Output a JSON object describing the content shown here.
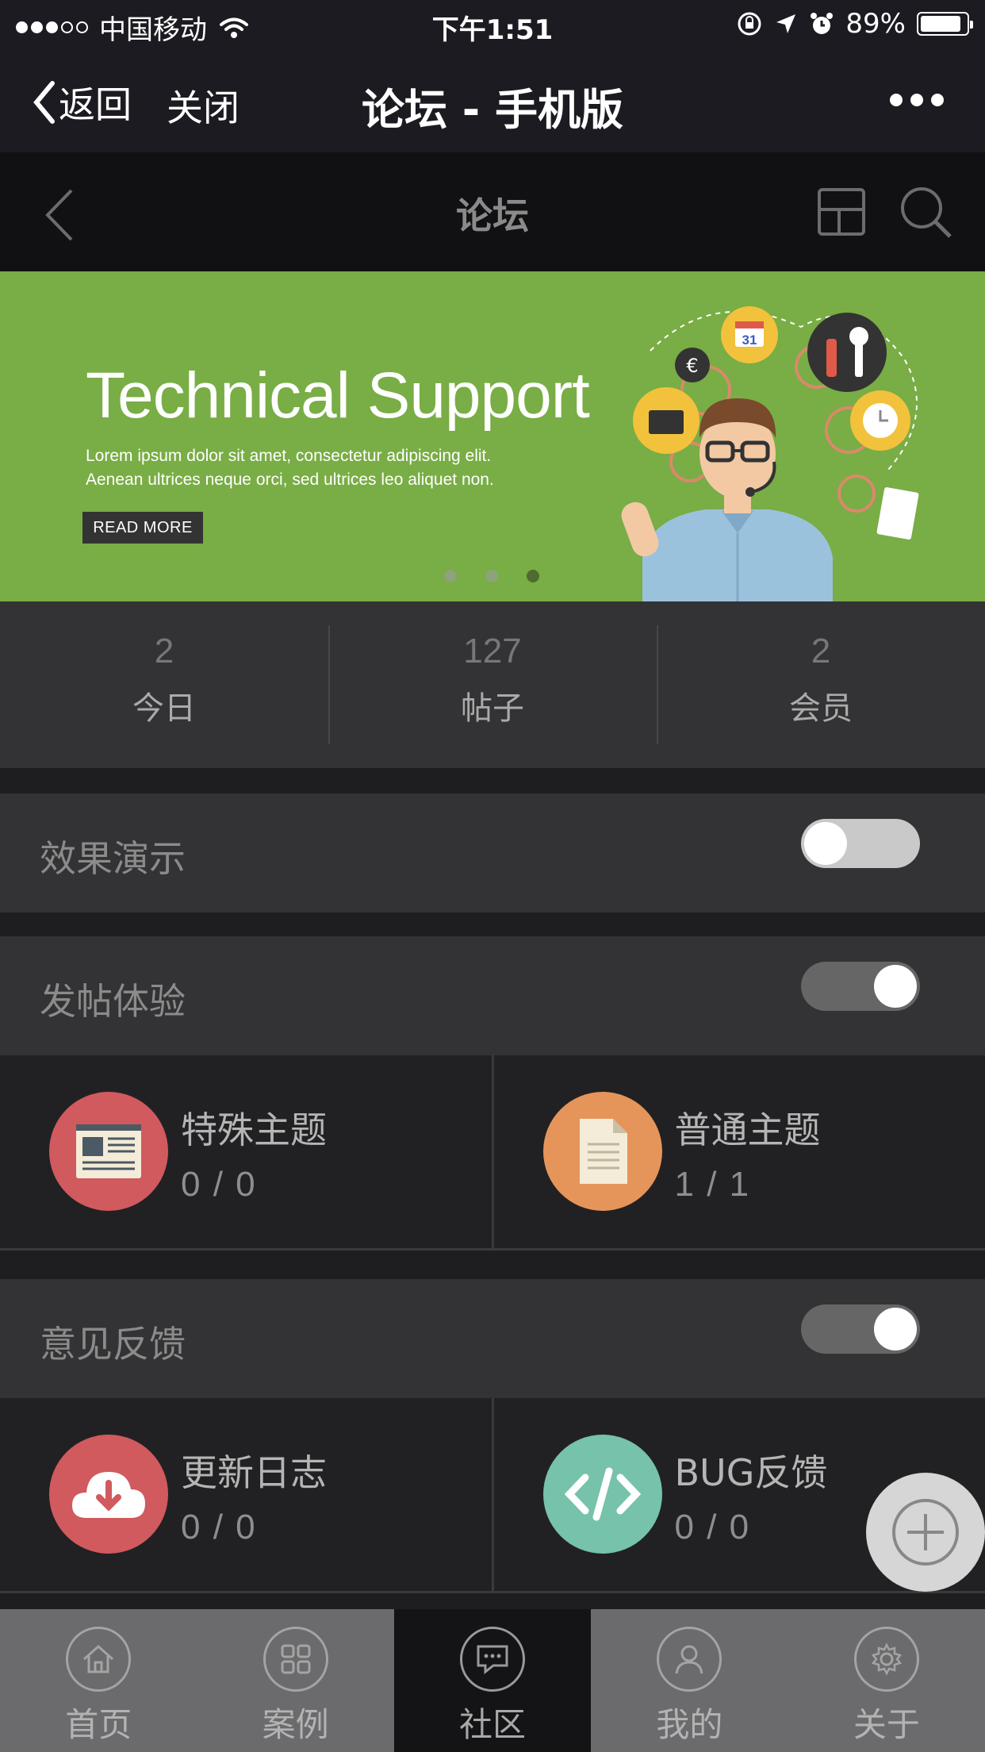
{
  "status_bar": {
    "carrier": "中国移动",
    "time": "下午1:51",
    "battery": "89%",
    "battery_level": 0.89
  },
  "wechat_nav": {
    "back_label": "返回",
    "close_label": "关闭",
    "title": "论坛 - 手机版"
  },
  "forum_header": {
    "title": "论坛"
  },
  "banner": {
    "headline": "Technical Support",
    "body_line1": "Lorem ipsum dolor sit amet, consectetur adipiscing elit.",
    "body_line2": "Aenean ultrices neque orci, sed ultrices leo aliquet non.",
    "button_label": "READ MORE",
    "slide_count": 3,
    "active_slide": 3,
    "calendar_number": "31",
    "currency_symbol": "€"
  },
  "stats": [
    {
      "value": "2",
      "label": "今日"
    },
    {
      "value": "127",
      "label": "帖子"
    },
    {
      "value": "2",
      "label": "会员"
    }
  ],
  "sections": [
    {
      "title": "效果演示",
      "toggle_on": false
    },
    {
      "title": "发帖体验",
      "toggle_on": true,
      "boards": [
        {
          "title": "特殊主题",
          "count": "0 / 0",
          "icon": "newspaper-icon",
          "color": "#d05a5e"
        },
        {
          "title": "普通主题",
          "count": "1 / 1",
          "icon": "document-icon",
          "color": "#e6955a"
        }
      ]
    },
    {
      "title": "意见反馈",
      "toggle_on": true,
      "boards": [
        {
          "title": "更新日志",
          "count": "0 / 0",
          "icon": "cloud-download-icon",
          "color": "#d05a5e"
        },
        {
          "title": "BUG反馈",
          "count": "0 / 0",
          "icon": "code-icon",
          "color": "#76c2aa"
        }
      ]
    }
  ],
  "tabbar": {
    "items": [
      {
        "label": "首页",
        "icon": "home-icon",
        "active": false
      },
      {
        "label": "案例",
        "icon": "grid-icon",
        "active": false
      },
      {
        "label": "社区",
        "icon": "chat-icon",
        "active": true
      },
      {
        "label": "我的",
        "icon": "user-icon",
        "active": false
      },
      {
        "label": "关于",
        "icon": "gear-icon",
        "active": false
      }
    ]
  }
}
